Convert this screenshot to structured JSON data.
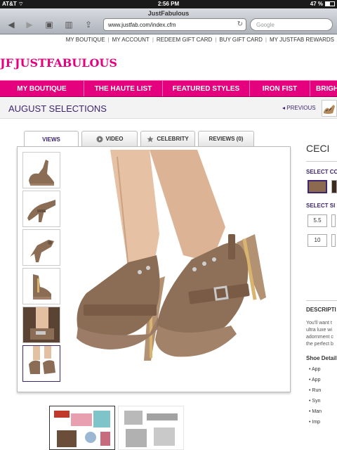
{
  "status_bar": {
    "carrier": "AT&T",
    "time": "2:56 PM",
    "battery": "47 %",
    "battery_level": 0.47
  },
  "browser": {
    "page_title": "JustFabulous",
    "url": "www.justfab.com/index.cfm",
    "search_placeholder": "Google"
  },
  "top_links": [
    "MY BOUTIQUE",
    "MY ACCOUNT",
    "REDEEM GIFT CARD",
    "BUY GIFT CARD",
    "MY JUSTFAB REWARDS"
  ],
  "logo": {
    "mark": "JF",
    "wordmark": "JUSTFABULOUS"
  },
  "nav": [
    "MY BOUTIQUE",
    "THE HAUTE LIST",
    "FEATURED STYLES",
    "IRON FIST",
    "BRIGH"
  ],
  "selection": {
    "title": "AUGUST SELECTIONS",
    "previous": "PREVIOUS"
  },
  "tabs": [
    {
      "label": "VIEWS",
      "icon": ""
    },
    {
      "label": "VIDEO",
      "icon": "play-icon"
    },
    {
      "label": "CELEBRITY",
      "icon": "star-icon"
    },
    {
      "label": "REVIEWS (0)",
      "icon": ""
    }
  ],
  "product": {
    "name": "CECI",
    "select_color_label": "SELECT CO",
    "select_size_label": "SELECT SI",
    "sizes": [
      "5.5",
      "",
      "10",
      ""
    ],
    "description_label": "DESCRIPTI",
    "description_lines": [
      "You'll want t",
      "ultra luxe wi",
      "adornment c",
      "the perfect b"
    ],
    "shoe_details_label": "Shoe Detail",
    "details": [
      "App",
      "App",
      "Run",
      "Syn",
      "Man",
      "Imp"
    ],
    "colors": {
      "swatch_primary": "#8c6a50",
      "swatch_secondary": "#3d2a1f",
      "brand_pink": "#e5007e",
      "brand_purple": "#3d2570"
    }
  }
}
